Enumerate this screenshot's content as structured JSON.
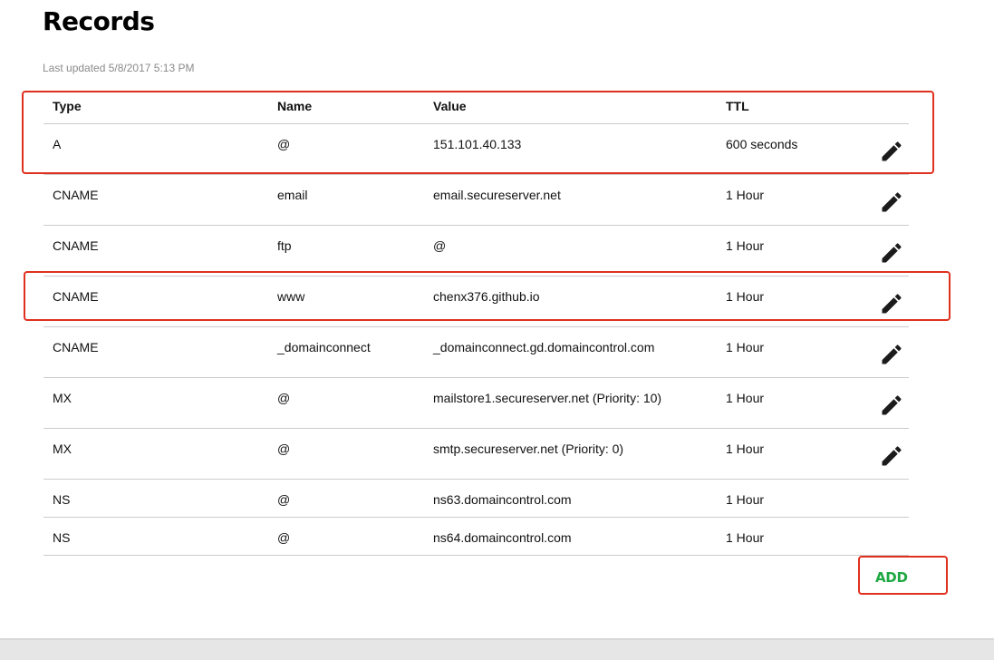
{
  "page": {
    "title": "Records",
    "last_updated": "Last updated 5/8/2017 5:13 PM"
  },
  "table": {
    "headers": {
      "type": "Type",
      "name": "Name",
      "value": "Value",
      "ttl": "TTL"
    },
    "rows": [
      {
        "type": "A",
        "name": "@",
        "value": "151.101.40.133",
        "ttl": "600 seconds",
        "editable": true
      },
      {
        "type": "CNAME",
        "name": "email",
        "value": "email.secureserver.net",
        "ttl": "1 Hour",
        "editable": true
      },
      {
        "type": "CNAME",
        "name": "ftp",
        "value": "@",
        "ttl": "1 Hour",
        "editable": true
      },
      {
        "type": "CNAME",
        "name": "www",
        "value": "chenx376.github.io",
        "ttl": "1 Hour",
        "editable": true
      },
      {
        "type": "CNAME",
        "name": "_domainconnect",
        "value": "_domainconnect.gd.domaincontrol.com",
        "ttl": "1 Hour",
        "editable": true
      },
      {
        "type": "MX",
        "name": "@",
        "value": "mailstore1.secureserver.net (Priority: 10)",
        "ttl": "1 Hour",
        "editable": true
      },
      {
        "type": "MX",
        "name": "@",
        "value": "smtp.secureserver.net (Priority: 0)",
        "ttl": "1 Hour",
        "editable": true
      },
      {
        "type": "NS",
        "name": "@",
        "value": "ns63.domaincontrol.com",
        "ttl": "1 Hour",
        "editable": false
      },
      {
        "type": "NS",
        "name": "@",
        "value": "ns64.domaincontrol.com",
        "ttl": "1 Hour",
        "editable": false
      }
    ]
  },
  "actions": {
    "add_label": "ADD"
  },
  "icons": {
    "edit": "pencil-icon"
  },
  "colors": {
    "add_accent": "#1ea842",
    "highlight": "#e0301e",
    "muted_text": "#8a8a8a",
    "divider": "#cccccc"
  }
}
